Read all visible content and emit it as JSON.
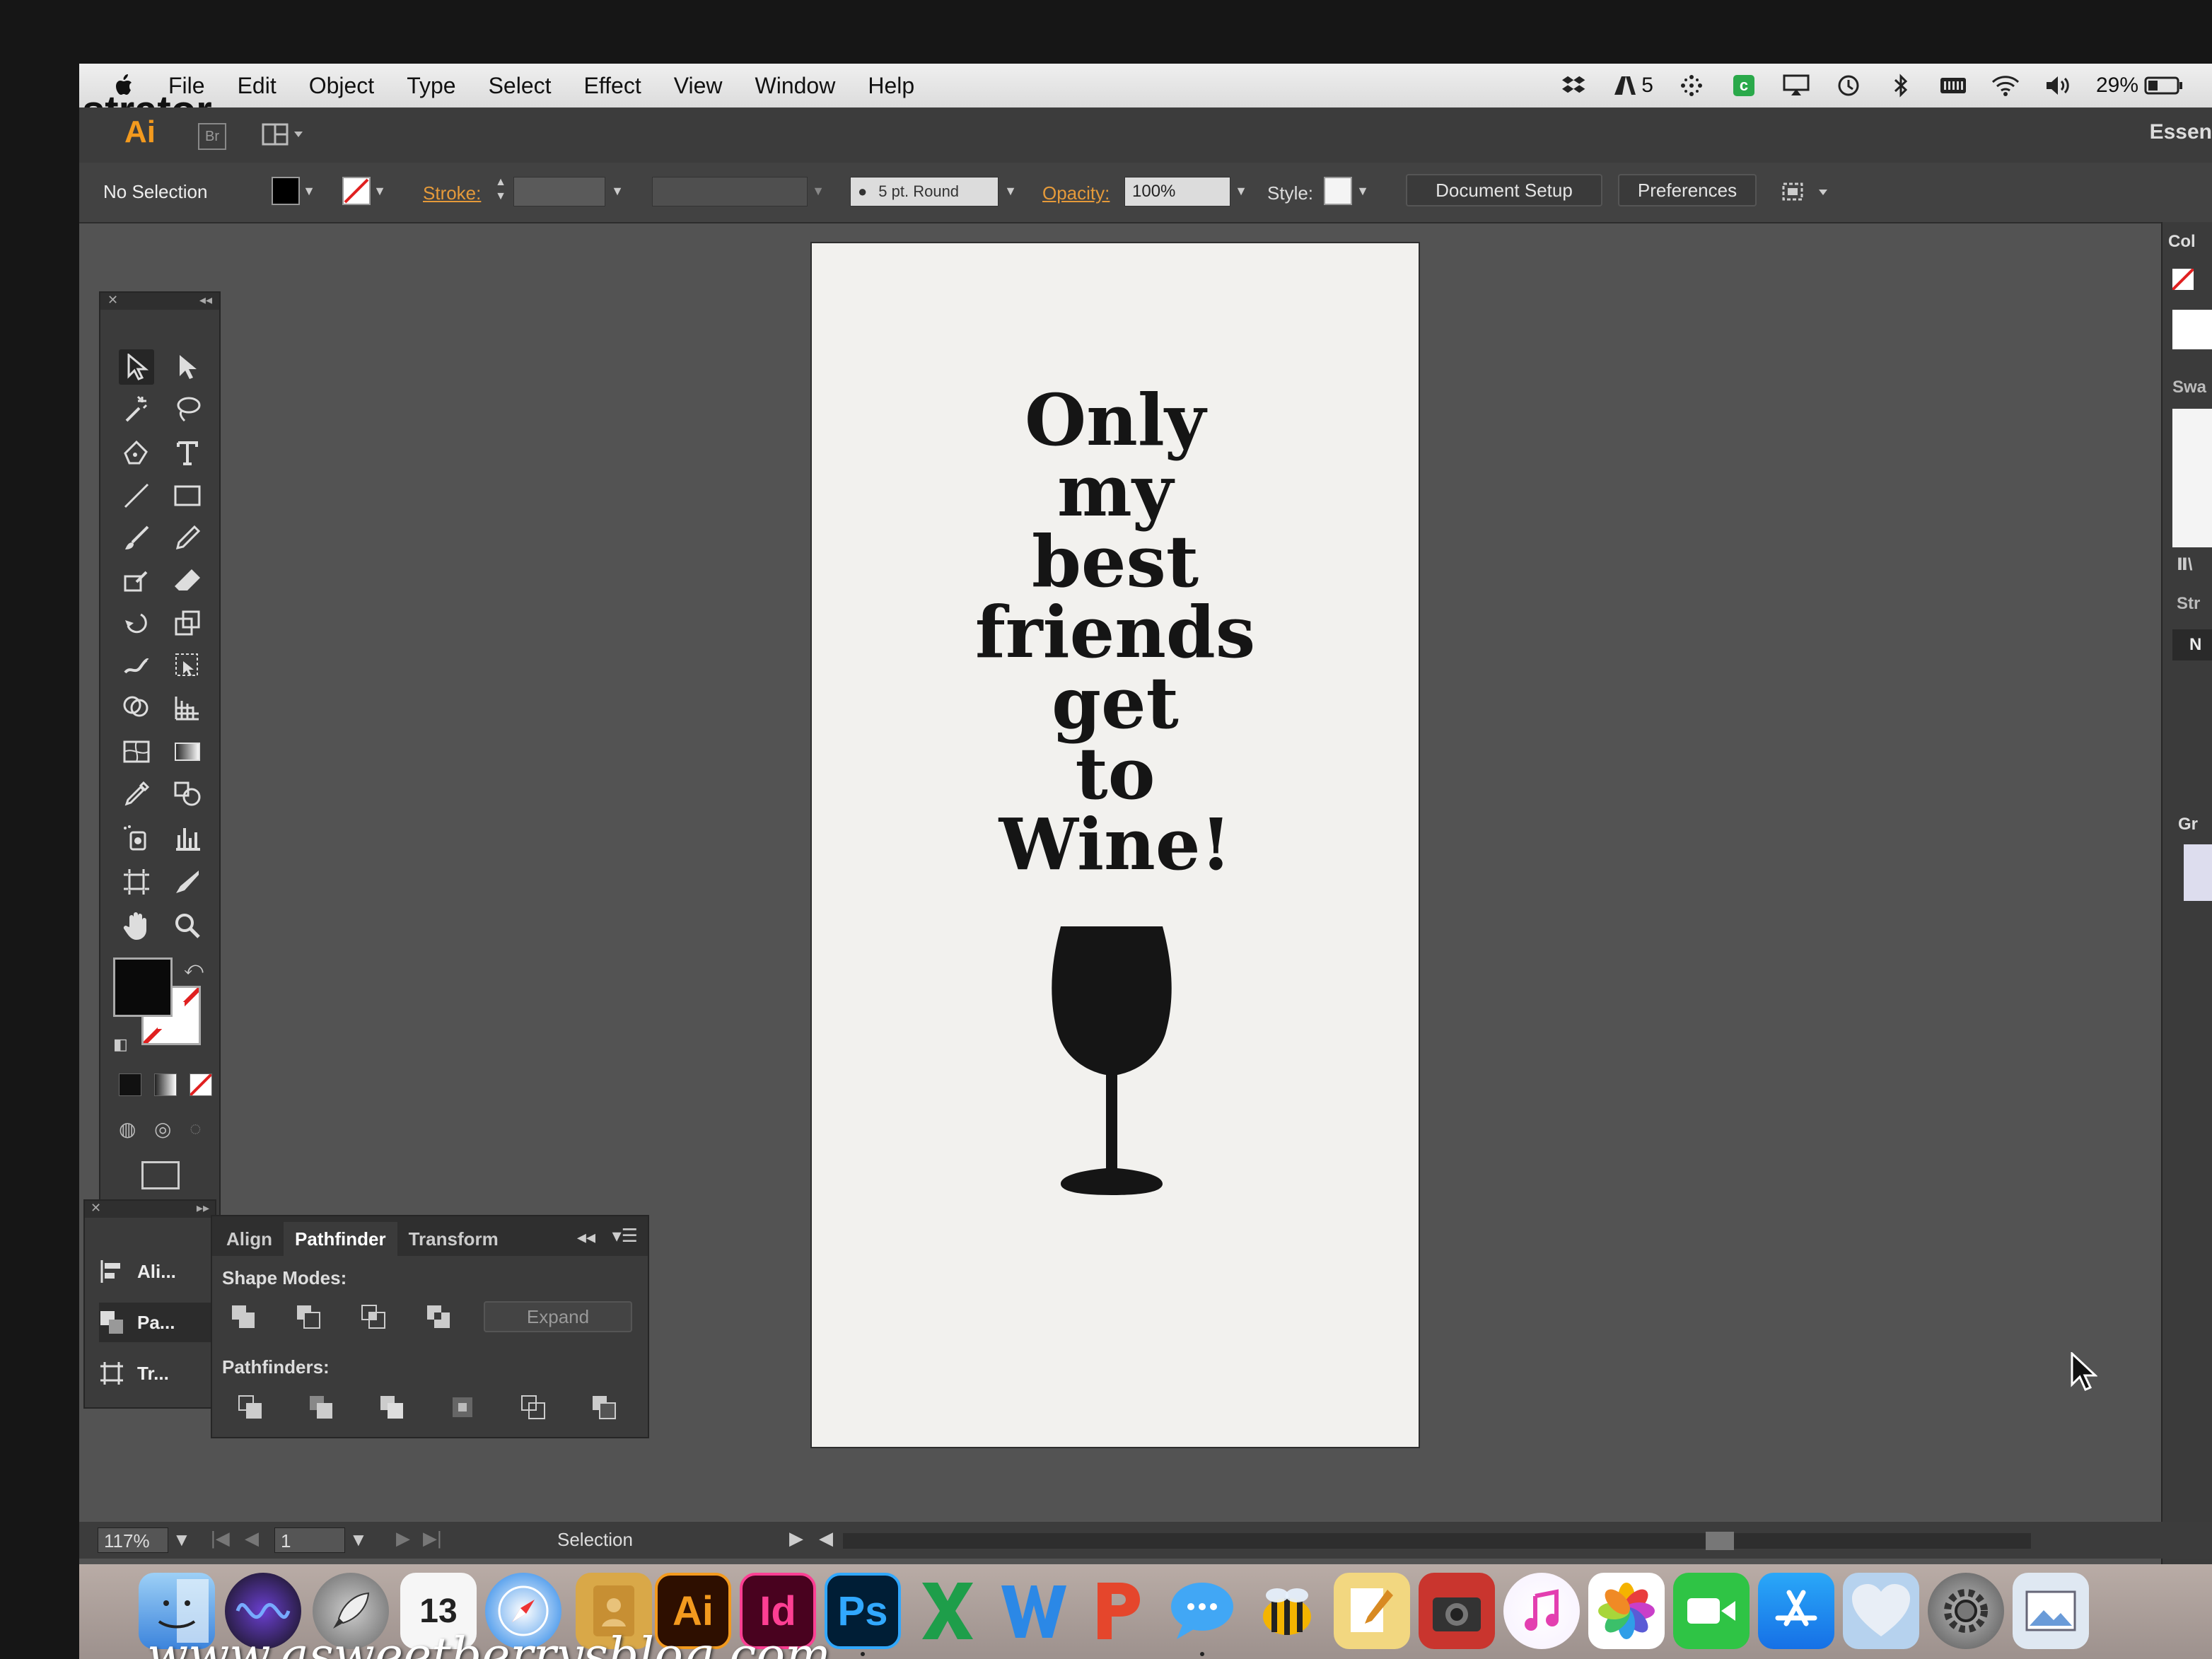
{
  "menubar": {
    "app_name": "Illustrator",
    "menus": [
      "File",
      "Edit",
      "Object",
      "Type",
      "Select",
      "Effect",
      "View",
      "Window",
      "Help"
    ],
    "status": {
      "adobe_count": "5",
      "battery": "29%"
    }
  },
  "app_bar": {
    "logo": "Ai",
    "bridge": "Br",
    "workspace": "Essen"
  },
  "control_bar": {
    "selection": "No Selection",
    "stroke_label": "Stroke:",
    "brush": "5 pt. Round",
    "opacity_label": "Opacity:",
    "opacity_value": "100%",
    "style_label": "Style:",
    "document_setup": "Document Setup",
    "preferences": "Preferences"
  },
  "sub_panel": {
    "items": [
      "Ali...",
      "Pa...",
      "Tr..."
    ]
  },
  "pathfinder": {
    "tabs": [
      "Align",
      "Pathfinder",
      "Transform"
    ],
    "shape_modes_label": "Shape Modes:",
    "expand": "Expand",
    "pathfinders_label": "Pathfinders:"
  },
  "artboard": {
    "lines": [
      "Only",
      "my",
      "best",
      "friends",
      "get",
      "to",
      "Wine!"
    ]
  },
  "right_dock": {
    "color_label": "Col",
    "swatches_label": "Swa",
    "stroke_label": "Str",
    "n_label": "N",
    "gradient_label": "Gr"
  },
  "status_bar": {
    "zoom": "117%",
    "artboard_num": "1",
    "tool": "Selection"
  },
  "dock": {
    "calendar_day": "13",
    "apps": [
      "Ai",
      "Id",
      "Ps"
    ]
  },
  "watermark": "www.asweetberrysblog.com",
  "colors": {
    "ai_orange": "#f39a1e",
    "indesign_pink": "#fd3f93",
    "photoshop_blue": "#31a8ff",
    "ui_dark": "#3b3b3b",
    "canvas": "#535353"
  }
}
